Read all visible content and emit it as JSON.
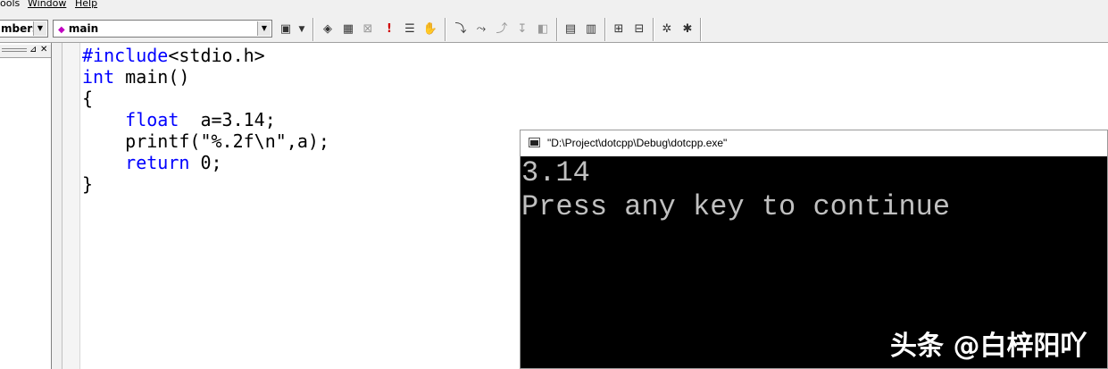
{
  "menu": {
    "items": [
      "ools",
      "Window",
      "Help"
    ]
  },
  "toolbar": {
    "members_combo": "mbers",
    "function_combo": "main",
    "icons": [
      "wizard-icon",
      "compile-icon",
      "build-icon",
      "stop-build-icon",
      "execute-icon",
      "go-icon",
      "insert-breakpoint-icon",
      "step-into-icon",
      "step-over-icon",
      "step-out-icon",
      "run-to-cursor-icon",
      "quickwatch-icon",
      "watch-icon",
      "variables-icon",
      "registers-icon",
      "memory-icon",
      "call-stack-icon",
      "disassembly-icon"
    ]
  },
  "editor": {
    "lines": [
      {
        "parts": [
          {
            "t": "#include",
            "c": "pp"
          },
          {
            "t": "<stdio.h>",
            "c": ""
          }
        ]
      },
      {
        "parts": [
          {
            "t": "int",
            "c": "kw"
          },
          {
            "t": " main()",
            "c": ""
          }
        ]
      },
      {
        "parts": [
          {
            "t": "{",
            "c": ""
          }
        ]
      },
      {
        "parts": [
          {
            "t": "    ",
            "c": ""
          },
          {
            "t": "float",
            "c": "kw"
          },
          {
            "t": "  a=3.14;",
            "c": ""
          }
        ]
      },
      {
        "parts": [
          {
            "t": "    printf(\"%.2f\\n\",a);",
            "c": ""
          }
        ]
      },
      {
        "parts": [
          {
            "t": "    ",
            "c": ""
          },
          {
            "t": "return",
            "c": "kw"
          },
          {
            "t": " 0;",
            "c": ""
          }
        ]
      },
      {
        "parts": [
          {
            "t": "}",
            "c": ""
          }
        ]
      }
    ]
  },
  "console": {
    "title": "\"D:\\Project\\dotcpp\\Debug\\dotcpp.exe\"",
    "output_line1": "3.14",
    "output_line2": "Press any key to continue"
  },
  "watermark": "头条 @白梓阳吖"
}
